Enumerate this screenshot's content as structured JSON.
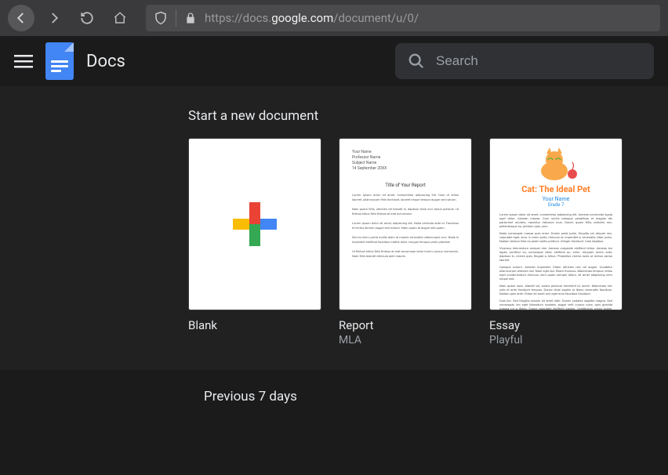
{
  "browser": {
    "url_dim_prefix": "https://docs.",
    "url_host": "google.com",
    "url_path": "/document/u/0/"
  },
  "app": {
    "title": "Docs",
    "search_placeholder": "Search"
  },
  "templates": {
    "heading": "Start a new document",
    "items": [
      {
        "name": "Blank",
        "style": ""
      },
      {
        "name": "Report",
        "style": "MLA"
      },
      {
        "name": "Essay",
        "style": "Playful"
      }
    ],
    "essay_preview": {
      "title": "Cat: The Ideal Pet",
      "name_line": "Your Name",
      "grade_line": "Grade 7"
    }
  },
  "recent": {
    "heading": "Previous 7 days"
  }
}
